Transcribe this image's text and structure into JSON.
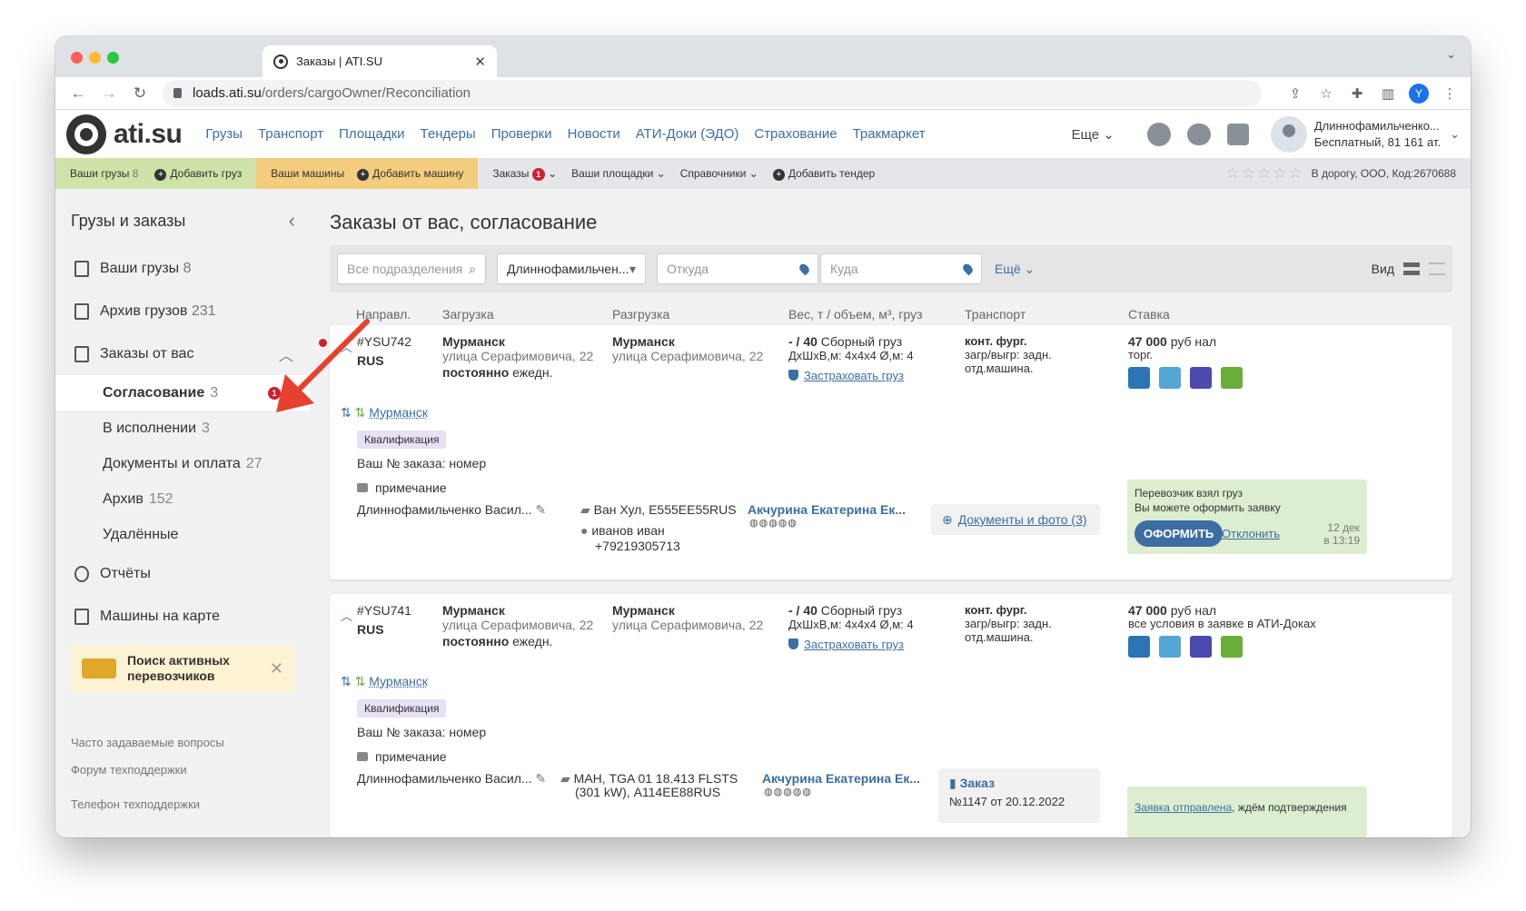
{
  "browser": {
    "tab_title": "Заказы | ATI.SU",
    "url_host": "loads.ati.su",
    "url_path": "/orders/cargoOwner/Reconciliation",
    "profile_letter": "Y"
  },
  "topnav": {
    "logo": "ati.su",
    "links": [
      "Грузы",
      "Транспорт",
      "Площадки",
      "Тендеры",
      "Проверки",
      "Новости",
      "АТИ-Доки (ЭДО)",
      "Страхование",
      "Тракмаркет"
    ],
    "more": "Еще",
    "user_name": "Длиннофамильченко...",
    "user_plan": "Бесплатный, 81 161 ат."
  },
  "subbar": {
    "your_cargo": "Ваши грузы",
    "your_cargo_count": "8",
    "add_cargo": "Добавить груз",
    "your_trucks": "Ваши машины",
    "add_truck": "Добавить машину",
    "orders": "Заказы",
    "orders_badge": "1",
    "your_sites": "Ваши площадки",
    "directories": "Справочники",
    "add_tender": "Добавить тендер",
    "stars": "☆☆☆☆☆",
    "company": "В дорогу, ООО,  Код:2670688"
  },
  "sidebar": {
    "title": "Грузы и заказы",
    "items": [
      {
        "label": "Ваши грузы",
        "count": "8"
      },
      {
        "label": "Архив грузов",
        "count": "231"
      },
      {
        "label": "Заказы от вас",
        "count": ""
      }
    ],
    "subitems": [
      {
        "label": "Согласование",
        "count": "3",
        "badge": "1"
      },
      {
        "label": "В исполнении",
        "count": "3"
      },
      {
        "label": "Документы и оплата",
        "count": "27"
      },
      {
        "label": "Архив",
        "count": "152"
      },
      {
        "label": "Удалённые",
        "count": ""
      }
    ],
    "reports": "Отчёты",
    "map": "Машины на карте",
    "promo": "Поиск активных перевозчиков",
    "faq": "Часто задаваемые вопросы",
    "forum": "Форум техподдержки",
    "phone": "Телефон техподдержки"
  },
  "main": {
    "title": "Заказы от вас, согласование",
    "filters": {
      "divisions_placeholder": "Все подразделения",
      "user": "Длиннофамильчен...",
      "from_placeholder": "Откуда",
      "to_placeholder": "Куда",
      "more": "Ещё",
      "view": "Вид"
    },
    "columns": [
      "Направл.",
      "Загрузка",
      "Разгрузка",
      "Вес, т / объем, м³, груз",
      "Транспорт",
      "Ставка"
    ]
  },
  "orders": [
    {
      "id": "#YSU742",
      "country": "RUS",
      "load_city": "Мурманск",
      "load_street": "улица Серафимовича, 22",
      "load_when": "постоянно",
      "load_freq": "ежедн.",
      "unload_city": "Мурманск",
      "unload_street": "улица Серафимовича, 22",
      "weight": "- / 40",
      "cargo": "Сборный груз",
      "dims": "ДхШхВ,м: 4х4х4 Ø,м: 4",
      "insure": "Застраховать груз",
      "transport": "конт. фург.",
      "loading": "загр/выгр: задн.",
      "separate": "отд.машина.",
      "rate": "47 000",
      "rate_unit": "руб нал",
      "rate_note": "торг.",
      "route": "Мурманск",
      "tag": "Квалификация",
      "order_no": "Ваш № заказа: номер",
      "comment": "примечание",
      "owner": "Длиннофамильченко Васил...",
      "truck": "Ван Хул, Е555ЕЕ55RUS",
      "driver": "иванов иван",
      "driver_phone": "+79219305713",
      "carrier": "Акчурина Екатерина Ек...",
      "carrier_rating": "◍◍◍◍◍",
      "docs": "Документы и фото (3)",
      "status1": "Перевозчик взял груз",
      "status2": "Вы можете оформить заявку",
      "btn": "ОФОРМИТЬ",
      "decline": "Отклонить",
      "date": "12 дек",
      "time": "в 13:19"
    },
    {
      "id": "#YSU741",
      "country": "RUS",
      "load_city": "Мурманск",
      "load_street": "улица Серафимовича, 22",
      "load_when": "постоянно",
      "load_freq": "ежедн.",
      "unload_city": "Мурманск",
      "unload_street": "улица Серафимовича, 22",
      "weight": "- / 40",
      "cargo": "Сборный груз",
      "dims": "ДхШхВ,м: 4х4х4 Ø,м: 4",
      "insure": "Застраховать груз",
      "transport": "конт. фург.",
      "loading": "загр/выгр: задн.",
      "separate": "отд.машина.",
      "rate": "47 000",
      "rate_unit": "руб нал",
      "rate_note": "все условия в заявке в АТИ-Доках",
      "route": "Мурманск",
      "tag": "Квалификация",
      "order_no": "Ваш № заказа: номер",
      "comment": "примечание",
      "owner": "Длиннофамильченко Васил...",
      "truck": "МАН, TGA 01 18.413 FLSTS",
      "truck2": "(301 kW), А114ЕЕ88RUS",
      "carrier": "Акчурина Екатерина Ек...",
      "carrier_rating": "◍◍◍◍◍",
      "doc_title": "Заказ",
      "doc_no": "№1147 от 20.12.2022",
      "sent_link": "Заявка отправлена",
      "sent_rest": ", ждём подтверждения"
    }
  ],
  "colors": {
    "link": "#3d6ea3",
    "badge": "#d0202d",
    "green_bg": "#ddeed0",
    "arrow": "#e8402f"
  }
}
